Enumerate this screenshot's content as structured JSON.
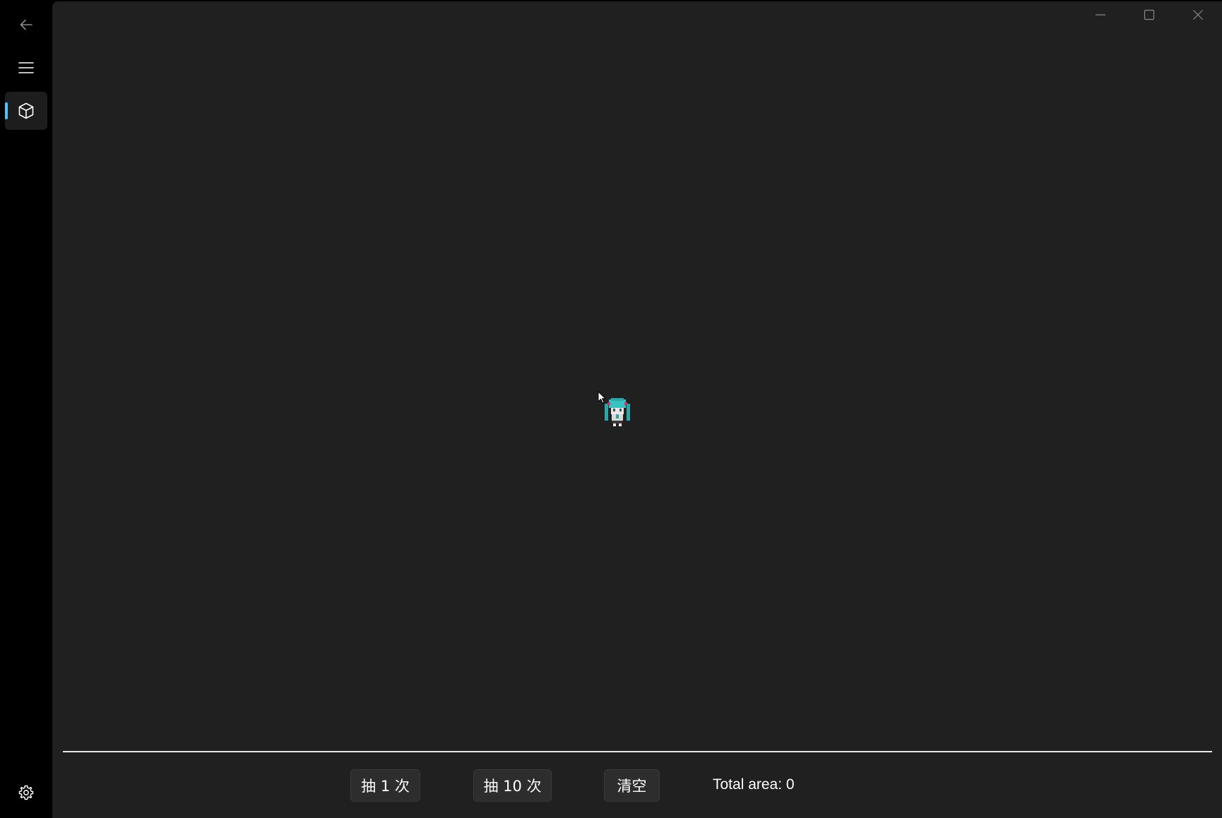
{
  "nav": {
    "back_icon": "back-arrow-icon",
    "menu_icon": "hamburger-menu-icon",
    "items": [
      {
        "icon": "cube-icon",
        "selected": true
      }
    ],
    "settings_icon": "gear-icon",
    "accent_color": "#4cc2ff"
  },
  "window_controls": {
    "minimize_icon": "minimize-icon",
    "maximize_icon": "maximize-icon",
    "close_icon": "close-icon"
  },
  "canvas": {
    "sprite_icon": "miku-chibi-sprite"
  },
  "actions": {
    "draw_once_label": "抽 1 次",
    "draw_ten_label": "抽 10 次",
    "clear_label": "清空"
  },
  "status": {
    "total_area_text": "Total area: 0"
  },
  "colors": {
    "content_bg": "#202020",
    "nav_bg": "#000000",
    "button_bg": "#2d2d2d"
  }
}
